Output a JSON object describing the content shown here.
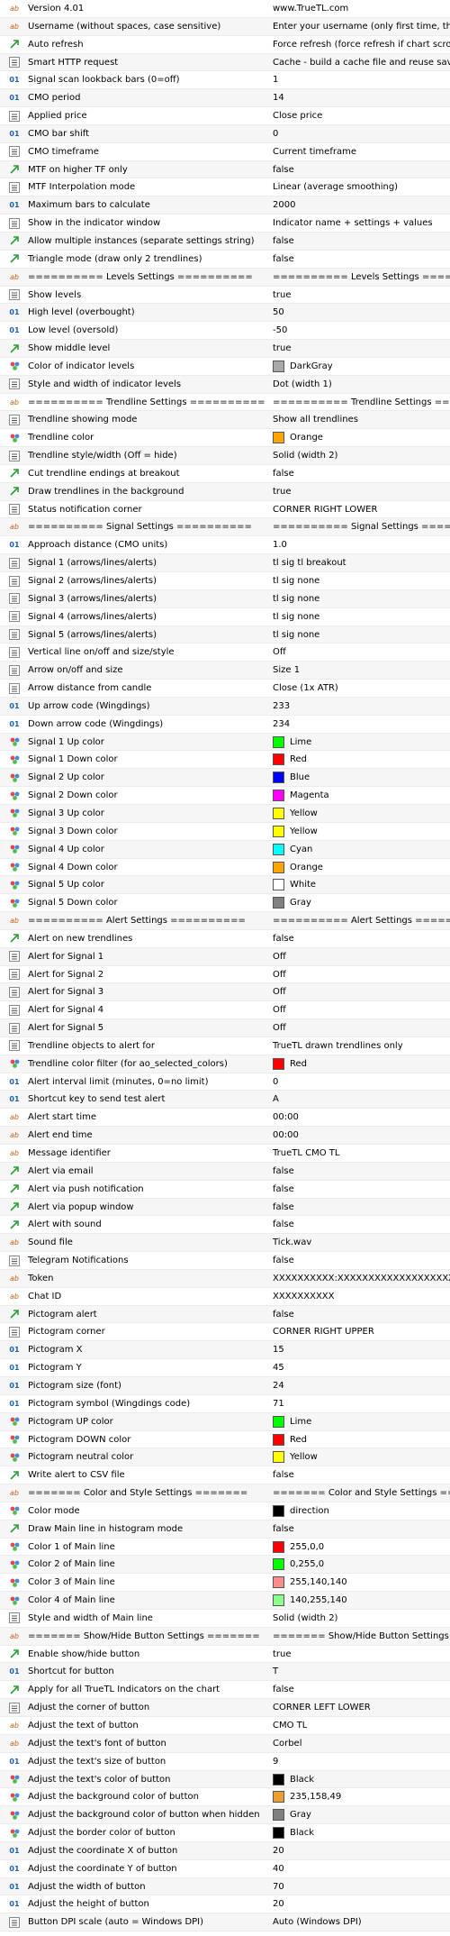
{
  "rows": [
    {
      "type": "text",
      "label": "Version 4.01",
      "value": "www.TrueTL.com"
    },
    {
      "type": "text",
      "label": "Username (without spaces, case sensitive)",
      "value": "Enter your username (only first time, then leave empty)"
    },
    {
      "type": "bool",
      "label": "Auto refresh",
      "value": "Force refresh (force refresh if chart scrolling)"
    },
    {
      "type": "list",
      "label": "Smart HTTP request",
      "value": "Cache - build a cache file and reuse saved results"
    },
    {
      "type": "num",
      "label": "Signal scan lookback bars (0=off)",
      "value": "1"
    },
    {
      "type": "num",
      "label": "CMO period",
      "value": "14"
    },
    {
      "type": "list",
      "label": "Applied price",
      "value": "Close price"
    },
    {
      "type": "num",
      "label": "CMO bar shift",
      "value": "0"
    },
    {
      "type": "list",
      "label": "CMO timeframe",
      "value": "Current timeframe"
    },
    {
      "type": "bool",
      "label": "MTF on higher TF only",
      "value": "false"
    },
    {
      "type": "list",
      "label": "MTF Interpolation mode",
      "value": "Linear (average smoothing)"
    },
    {
      "type": "num",
      "label": "Maximum bars to calculate",
      "value": "2000"
    },
    {
      "type": "list",
      "label": "Show in the indicator window",
      "value": "Indicator name + settings + values"
    },
    {
      "type": "bool",
      "label": "Allow multiple instances (separate settings string)",
      "value": "false"
    },
    {
      "type": "bool",
      "label": "Triangle mode (draw only 2 trendlines)",
      "value": "false"
    },
    {
      "type": "text",
      "label": "========== Levels Settings ==========",
      "value": "========== Levels Settings =========="
    },
    {
      "type": "list",
      "label": "Show levels",
      "value": "true"
    },
    {
      "type": "num",
      "label": "High level (overbought)",
      "value": "50"
    },
    {
      "type": "num",
      "label": "Low level (oversold)",
      "value": "-50"
    },
    {
      "type": "bool",
      "label": "Show middle level",
      "value": "true"
    },
    {
      "type": "color",
      "label": "Color of indicator levels",
      "value": "DarkGray",
      "color": "#a9a9a9"
    },
    {
      "type": "list",
      "label": "Style and width of indicator levels",
      "value": "Dot (width 1)"
    },
    {
      "type": "text",
      "label": "========== Trendline Settings ==========",
      "value": "========== Trendline Settings =========="
    },
    {
      "type": "list",
      "label": "Trendline showing mode",
      "value": "Show all trendlines"
    },
    {
      "type": "color",
      "label": "Trendline color",
      "value": "Orange",
      "color": "#ffa500"
    },
    {
      "type": "list",
      "label": "Trendline style/width (Off = hide)",
      "value": "Solid (width 2)"
    },
    {
      "type": "bool",
      "label": "Cut trendline endings at breakout",
      "value": "false"
    },
    {
      "type": "bool",
      "label": "Draw trendlines in the background",
      "value": "true"
    },
    {
      "type": "list",
      "label": "Status notification corner",
      "value": "CORNER RIGHT LOWER"
    },
    {
      "type": "text",
      "label": "========== Signal Settings ==========",
      "value": "========== Signal Settings =========="
    },
    {
      "type": "num",
      "label": "Approach distance (CMO units)",
      "value": "1.0"
    },
    {
      "type": "list",
      "label": "Signal 1 (arrows/lines/alerts)",
      "value": "tl sig tl breakout"
    },
    {
      "type": "list",
      "label": "Signal 2 (arrows/lines/alerts)",
      "value": "tl sig none"
    },
    {
      "type": "list",
      "label": "Signal 3 (arrows/lines/alerts)",
      "value": "tl sig none"
    },
    {
      "type": "list",
      "label": "Signal 4 (arrows/lines/alerts)",
      "value": "tl sig none"
    },
    {
      "type": "list",
      "label": "Signal 5 (arrows/lines/alerts)",
      "value": "tl sig none"
    },
    {
      "type": "list",
      "label": "Vertical line on/off and size/style",
      "value": "Off"
    },
    {
      "type": "list",
      "label": "Arrow on/off and size",
      "value": "Size 1"
    },
    {
      "type": "list",
      "label": "Arrow distance from candle",
      "value": "Close (1x ATR)"
    },
    {
      "type": "num",
      "label": "Up arrow code (Wingdings)",
      "value": "233"
    },
    {
      "type": "num",
      "label": "Down arrow code (Wingdings)",
      "value": "234"
    },
    {
      "type": "color",
      "label": "Signal 1 Up color",
      "value": "Lime",
      "color": "#00ff00"
    },
    {
      "type": "color",
      "label": "Signal 1 Down color",
      "value": "Red",
      "color": "#ff0000"
    },
    {
      "type": "color",
      "label": "Signal 2 Up color",
      "value": "Blue",
      "color": "#0000ff"
    },
    {
      "type": "color",
      "label": "Signal 2 Down color",
      "value": "Magenta",
      "color": "#ff00ff"
    },
    {
      "type": "color",
      "label": "Signal 3 Up color",
      "value": "Yellow",
      "color": "#ffff00"
    },
    {
      "type": "color",
      "label": "Signal 3 Down color",
      "value": "Yellow",
      "color": "#ffff00"
    },
    {
      "type": "color",
      "label": "Signal 4 Up color",
      "value": "Cyan",
      "color": "#00ffff"
    },
    {
      "type": "color",
      "label": "Signal 4 Down color",
      "value": "Orange",
      "color": "#ffa500"
    },
    {
      "type": "color",
      "label": "Signal 5 Up color",
      "value": "White",
      "color": "#ffffff"
    },
    {
      "type": "color",
      "label": "Signal 5 Down color",
      "value": "Gray",
      "color": "#808080"
    },
    {
      "type": "text",
      "label": "========== Alert Settings ==========",
      "value": "========== Alert Settings =========="
    },
    {
      "type": "bool",
      "label": "Alert on new trendlines",
      "value": "false"
    },
    {
      "type": "list",
      "label": "Alert for Signal 1",
      "value": "Off"
    },
    {
      "type": "list",
      "label": "Alert for Signal 2",
      "value": "Off"
    },
    {
      "type": "list",
      "label": "Alert for Signal 3",
      "value": "Off"
    },
    {
      "type": "list",
      "label": "Alert for Signal 4",
      "value": "Off"
    },
    {
      "type": "list",
      "label": "Alert for Signal 5",
      "value": "Off"
    },
    {
      "type": "list",
      "label": "Trendline objects to alert for",
      "value": "TrueTL drawn trendlines only"
    },
    {
      "type": "color",
      "label": "Trendline color filter (for ao_selected_colors)",
      "value": "Red",
      "color": "#ff0000"
    },
    {
      "type": "num",
      "label": "Alert interval limit (minutes, 0=no limit)",
      "value": "0"
    },
    {
      "type": "num",
      "label": "Shortcut key to send test alert",
      "value": "A"
    },
    {
      "type": "text",
      "label": "Alert start time",
      "value": "00:00"
    },
    {
      "type": "text",
      "label": "Alert end time",
      "value": "00:00"
    },
    {
      "type": "text",
      "label": "Message identifier",
      "value": "TrueTL CMO TL"
    },
    {
      "type": "bool",
      "label": "Alert via email",
      "value": "false"
    },
    {
      "type": "bool",
      "label": "Alert via push notification",
      "value": "false"
    },
    {
      "type": "bool",
      "label": "Alert via popup window",
      "value": "false"
    },
    {
      "type": "bool",
      "label": "Alert with sound",
      "value": "false"
    },
    {
      "type": "text",
      "label": "Sound file",
      "value": "Tick.wav"
    },
    {
      "type": "list",
      "label": "Telegram Notifications",
      "value": "false"
    },
    {
      "type": "text",
      "label": "Token",
      "value": "XXXXXXXXXX:XXXXXXXXXXXXXXXXXXXXXXXXXXXXXXXXXXX"
    },
    {
      "type": "text",
      "label": "Chat ID",
      "value": "XXXXXXXXXX"
    },
    {
      "type": "bool",
      "label": "Pictogram alert",
      "value": "false"
    },
    {
      "type": "list",
      "label": "Pictogram corner",
      "value": "CORNER RIGHT UPPER"
    },
    {
      "type": "num",
      "label": "Pictogram X",
      "value": "15"
    },
    {
      "type": "num",
      "label": "Pictogram Y",
      "value": "45"
    },
    {
      "type": "num",
      "label": "Pictogram size (font)",
      "value": "24"
    },
    {
      "type": "num",
      "label": "Pictogram symbol (Wingdings code)",
      "value": "71"
    },
    {
      "type": "color",
      "label": "Pictogram UP color",
      "value": "Lime",
      "color": "#00ff00"
    },
    {
      "type": "color",
      "label": "Pictogram DOWN color",
      "value": "Red",
      "color": "#ff0000"
    },
    {
      "type": "color",
      "label": "Pictogram neutral color",
      "value": "Yellow",
      "color": "#ffff00"
    },
    {
      "type": "bool",
      "label": "Write alert to CSV file",
      "value": "false"
    },
    {
      "type": "text",
      "label": "======= Color and Style Settings =======",
      "value": "======= Color and Style Settings ======="
    },
    {
      "type": "color",
      "label": "Color mode",
      "value": "direction",
      "color": "#000000"
    },
    {
      "type": "bool",
      "label": "Draw Main line in histogram mode",
      "value": "false"
    },
    {
      "type": "color",
      "label": "Color 1 of Main line",
      "value": "255,0,0",
      "color": "#ff0000"
    },
    {
      "type": "color",
      "label": "Color 2 of Main line",
      "value": "0,255,0",
      "color": "#00ff00"
    },
    {
      "type": "color",
      "label": "Color 3 of Main line",
      "value": "255,140,140",
      "color": "#ff8c8c"
    },
    {
      "type": "color",
      "label": "Color 4 of Main line",
      "value": "140,255,140",
      "color": "#8cff8c"
    },
    {
      "type": "list",
      "label": "Style and width of Main line",
      "value": "Solid (width 2)"
    },
    {
      "type": "text",
      "label": "======= Show/Hide Button Settings =======",
      "value": "======= Show/Hide Button Settings ======="
    },
    {
      "type": "bool",
      "label": "Enable show/hide button",
      "value": "true"
    },
    {
      "type": "num",
      "label": "Shortcut for button",
      "value": "T"
    },
    {
      "type": "bool",
      "label": "Apply for all TrueTL Indicators on the chart",
      "value": "false"
    },
    {
      "type": "list",
      "label": "Adjust the corner of button",
      "value": "CORNER LEFT LOWER"
    },
    {
      "type": "text",
      "label": "Adjust the text of button",
      "value": "CMO TL"
    },
    {
      "type": "text",
      "label": "Adjust the text's font of button",
      "value": "Corbel"
    },
    {
      "type": "num",
      "label": "Adjust the text's size of button",
      "value": "9"
    },
    {
      "type": "color",
      "label": "Adjust the text's color of button",
      "value": "Black",
      "color": "#000000"
    },
    {
      "type": "color",
      "label": "Adjust the background color of button",
      "value": "235,158,49",
      "color": "#eb9e31"
    },
    {
      "type": "color",
      "label": "Adjust the background color of button when hidden",
      "value": "Gray",
      "color": "#808080"
    },
    {
      "type": "color",
      "label": "Adjust the border color of button",
      "value": "Black",
      "color": "#000000"
    },
    {
      "type": "num",
      "label": "Adjust the coordinate X of button",
      "value": "20"
    },
    {
      "type": "num",
      "label": "Adjust the coordinate Y of button",
      "value": "40"
    },
    {
      "type": "num",
      "label": "Adjust the width of button",
      "value": "70"
    },
    {
      "type": "num",
      "label": "Adjust the height of button",
      "value": "20"
    },
    {
      "type": "list",
      "label": "Button DPI scale (auto = Windows DPI)",
      "value": "Auto (Windows DPI)"
    }
  ]
}
